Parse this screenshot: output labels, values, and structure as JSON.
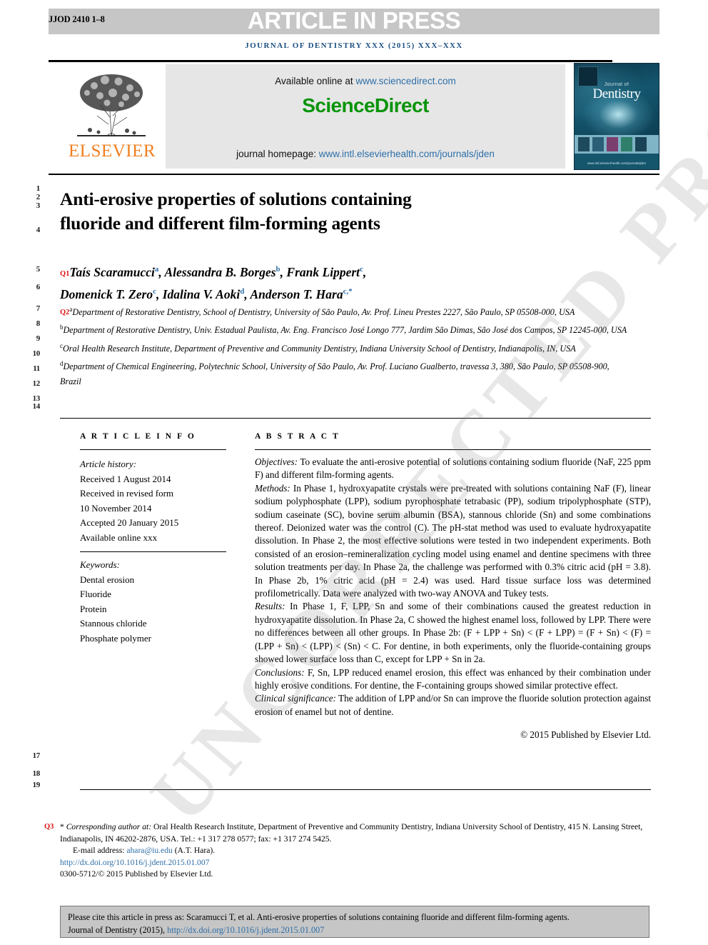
{
  "header": {
    "article_id": "JJOD 2410 1–8",
    "banner": "ARTICLE IN PRESS",
    "journal_line": "JOURNAL OF DENTISTRY XXX (2015) XXX–XXX",
    "banner_bg": "#c6c6c6",
    "journal_line_color": "#1b4f82"
  },
  "masthead": {
    "publisher": "ELSEVIER",
    "publisher_color": "#f07f20",
    "available_prefix": "Available online at",
    "available_url": "www.sciencedirect.com",
    "sciencedirect": "ScienceDirect",
    "sciencedirect_color": "#089409",
    "homepage_prefix": "journal homepage:",
    "homepage_url": "www.intl.elsevierhealth.com/journals/jden",
    "cover": {
      "series_label": "Journal of",
      "title": "Dentistry",
      "footer_note": "www.intl.elsevierhealth.com/journals/jden"
    }
  },
  "article": {
    "title_line1": "Anti-erosive properties of solutions containing",
    "title_line2": "fluoride and different film-forming agents",
    "query_markers": {
      "q1": "Q1",
      "q2": "Q2",
      "q3": "Q3"
    },
    "authors": [
      {
        "name": "Taís Scaramucci",
        "sup": "a",
        "sep": ", "
      },
      {
        "name": "Alessandra B. Borges",
        "sup": "b",
        "sep": ", "
      },
      {
        "name": "Frank Lippert",
        "sup": "c",
        "sep": ","
      },
      {
        "name": "Domenick T. Zero",
        "sup": "c",
        "sep": ", "
      },
      {
        "name": "Idalina V. Aoki",
        "sup": "d",
        "sep": ", "
      },
      {
        "name": "Anderson T. Hara",
        "sup": "c,*",
        "sep": ""
      }
    ],
    "affiliations": [
      {
        "label": "a",
        "text": "Department of Restorative Dentistry, School of Dentistry, University of São Paulo, Av. Prof. Lineu Prestes 2227, São Paulo, SP 05508-000, USA"
      },
      {
        "label": "b",
        "text": "Department of Restorative Dentistry, Univ. Estadual Paulista, Av. Eng. Francisco José Longo 777, Jardim São Dimas, São José dos Campos, SP 12245-000, USA"
      },
      {
        "label": "c",
        "text": "Oral Health Research Institute, Department of Preventive and Community Dentistry, Indiana University School of Dentistry, Indianapolis, IN, USA"
      },
      {
        "label": "d",
        "text": "Department of Chemical Engineering, Polytechnic School, University of São Paulo, Av. Prof. Luciano Gualberto, travessa 3, 380, São Paulo, SP 05508-900, Brazil"
      }
    ]
  },
  "article_info": {
    "heading": "A R T I C L E   I N F O",
    "history_label": "Article history:",
    "history": [
      "Received 1 August 2014",
      "Received in revised form",
      "10 November 2014",
      "Accepted 20 January 2015",
      "Available online xxx"
    ],
    "keywords_label": "Keywords:",
    "keywords": [
      "Dental erosion",
      "Fluoride",
      "Protein",
      "Stannous chloride",
      "Phosphate polymer"
    ]
  },
  "abstract": {
    "heading": "A B S T R A C T",
    "sections": [
      {
        "label": "Objectives:",
        "text": " To evaluate the anti-erosive potential of solutions containing sodium fluoride (NaF, 225 ppm F) and different film-forming agents."
      },
      {
        "label": "Methods:",
        "text": " In Phase 1, hydroxyapatite crystals were pre-treated with solutions containing NaF (F), linear sodium polyphosphate (LPP), sodium pyrophosphate tetrabasic (PP), sodium tripolyphosphate (STP), sodium caseinate (SC), bovine serum albumin (BSA), stannous chloride (Sn) and some combinations thereof. Deionized water was the control (C). The pH-stat method was used to evaluate hydroxyapatite dissolution. In Phase 2, the most effective solutions were tested in two independent experiments. Both consisted of an erosion–remineralization cycling model using enamel and dentine specimens with three solution treatments per day. In Phase 2a, the challenge was performed with 0.3% citric acid (pH = 3.8). In Phase 2b, 1% citric acid (pH = 2.4) was used. Hard tissue surface loss was determined profilometrically. Data were analyzed with two-way ANOVA and Tukey tests."
      },
      {
        "label": "Results:",
        "text": " In Phase 1, F, LPP, Sn and some of their combinations caused the greatest reduction in hydroxyapatite dissolution. In Phase 2a, C showed the highest enamel loss, followed by LPP. There were no differences between all other groups. In Phase 2b: (F + LPP + Sn) < (F + LPP) = (F + Sn) < (F) = (LPP + Sn) < (LPP) < (Sn) < C. For dentine, in both experiments, only the fluoride-containing groups showed lower surface loss than C, except for LPP + Sn in 2a."
      },
      {
        "label": "Conclusions:",
        "text": " F, Sn, LPP reduced enamel erosion, this effect was enhanced by their combination under highly erosive conditions. For dentine, the F-containing groups showed similar protective effect."
      },
      {
        "label": "Clinical significance:",
        "text": " The addition of LPP and/or Sn can improve the fluoride solution protection against erosion of enamel but not of dentine."
      }
    ],
    "copyright": "© 2015 Published by Elsevier Ltd."
  },
  "footnotes": {
    "corresponding_label": "Corresponding author at:",
    "corresponding_text": " Oral Health Research Institute, Department of Preventive and Community Dentistry, Indiana University School of Dentistry, 415 N. Lansing Street, Indianapolis, IN 46202-2876, USA. Tel.: +1 317 278 0577; fax: +1 317 274 5425.",
    "email_label": "E-mail address:",
    "email": "ahara@iu.edu",
    "email_suffix": " (A.T. Hara).",
    "doi": "http://dx.doi.org/10.1016/j.jdent.2015.01.007",
    "issn_line": "0300-5712/© 2015 Published by Elsevier Ltd."
  },
  "citation_box": {
    "line1": "Please cite this article in press as: Scaramucci T, et al. Anti-erosive properties of solutions containing fluoride and different film-forming agents.",
    "line2_prefix": "Journal of Dentistry (2015), ",
    "line2_link": "http://dx.doi.org/10.1016/j.jdent.2015.01.007"
  },
  "watermark": "UNCORRECTED PROOF",
  "line_numbers": {
    "top": [
      "1",
      "2",
      "3",
      "4",
      "5",
      "6",
      "7",
      "8",
      "9",
      "10",
      "11",
      "12",
      "13",
      "14"
    ],
    "bottom": [
      "17",
      "18",
      "19"
    ]
  }
}
